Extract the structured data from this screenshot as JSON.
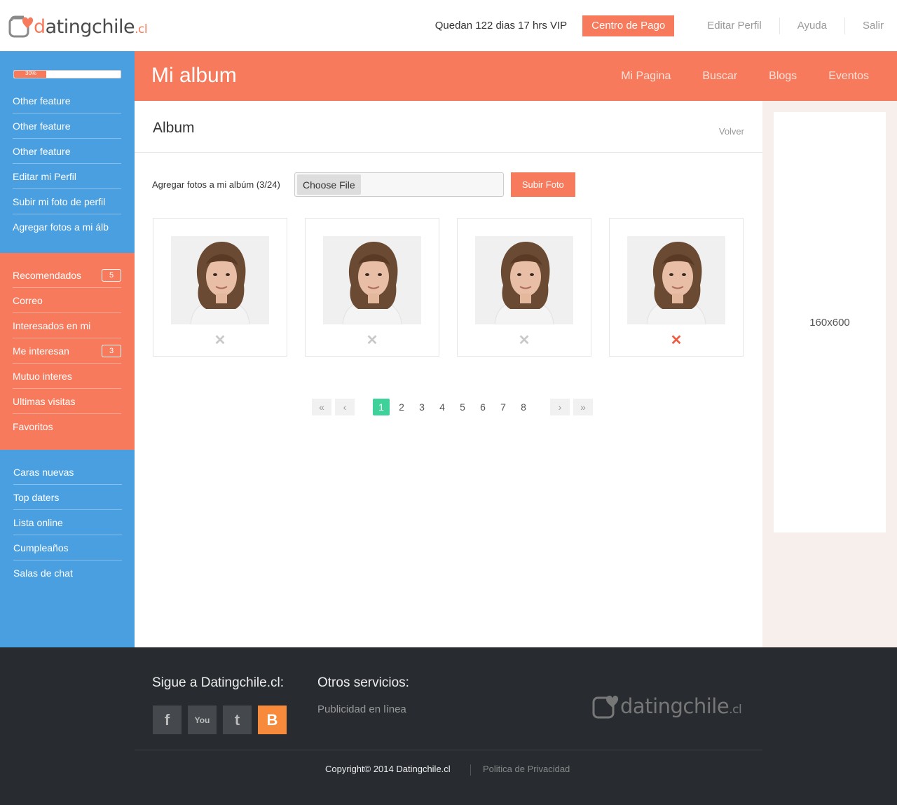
{
  "header": {
    "logo": {
      "prefix": "d",
      "name": "atingchile",
      "suffix": ".cl"
    },
    "vip_status": "Quedan 122 dias 17 hrs VIP",
    "pay_button": "Centro de Pago",
    "links": [
      "Editar Perfil",
      "Ayuda",
      "Salir"
    ]
  },
  "sidebar": {
    "progress_percent": 30,
    "progress_label": "30%",
    "section1": [
      "Other feature",
      "Other feature",
      "Other feature",
      "Editar mi Perfil",
      "Subir mi foto de perfil",
      "Agregar fotos a mi álb"
    ],
    "section2": [
      {
        "label": "Recomendados",
        "badge": "5"
      },
      {
        "label": "Correo"
      },
      {
        "label": "Interesados en mi"
      },
      {
        "label": "Me interesan",
        "badge": "3"
      },
      {
        "label": "Mutuo interes"
      },
      {
        "label": "Ultimas visitas"
      },
      {
        "label": "Favoritos"
      }
    ],
    "section3": [
      "Caras nuevas",
      "Top daters",
      "Lista online",
      "Cumpleaños",
      "Salas de chat"
    ]
  },
  "band": {
    "title": "Mi album",
    "nav": [
      "Mi Pagina",
      "Buscar",
      "Blogs",
      "Eventos"
    ]
  },
  "album": {
    "title": "Album",
    "back_link": "Volver",
    "upload_label": "Agregar fotos a mi albúm (3/24)",
    "choose_file": "Choose File",
    "upload_button": "Subir Foto",
    "photo_count": 4,
    "delete_symbol": "✕",
    "highlighted_delete_index": 3
  },
  "pagination": {
    "pages": [
      "1",
      "2",
      "3",
      "4",
      "5",
      "6",
      "7",
      "8"
    ],
    "current": "1",
    "first": "«",
    "prev": "‹",
    "next": "›",
    "last": "»"
  },
  "ad": {
    "label": "160x600"
  },
  "footer": {
    "follow_title": "Sigue a Datingchile.cl:",
    "social": [
      {
        "icon": "facebook-icon",
        "glyph": "f"
      },
      {
        "icon": "youtube-icon",
        "glyph": "You"
      },
      {
        "icon": "twitter-icon",
        "glyph": "t"
      },
      {
        "icon": "blogger-icon",
        "glyph": "B"
      }
    ],
    "otros_title": "Otros servicios:",
    "otros_link": "Publicidad en línea",
    "copyright": "Copyright© 2014  Datingchile.cl",
    "privacy": "Politica de Privacidad"
  },
  "colors": {
    "accent": "#f77a5c",
    "blue": "#4a9fe0",
    "green": "#3ed29a",
    "footer": "#282c30"
  }
}
